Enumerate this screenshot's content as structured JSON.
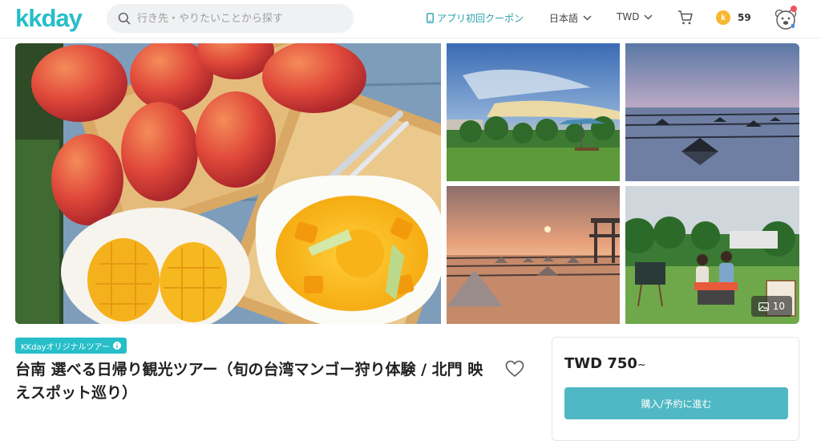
{
  "header": {
    "logo": "kkday",
    "search_placeholder": "行き先・やりたいことから探す",
    "coupon_label": "アプリ初回クーポン",
    "language_label": "日本語",
    "currency_label": "TWD",
    "points": "59",
    "points_coin": "k"
  },
  "gallery": {
    "photo_count": "10"
  },
  "product": {
    "badge": "KKdayオリジナルツアー",
    "title": "台南 選べる日帰り観光ツアー（旬の台湾マンゴー狩り体験 / 北門 映えスポット巡り）"
  },
  "booking": {
    "price": "TWD 750",
    "price_suffix": "~",
    "button_label": "購入/予約に進む"
  },
  "colors": {
    "brand": "#26bec9",
    "coupon": "#26a2ad",
    "button": "#4fb8c4",
    "points_coin": "#f7b731",
    "notification": "#f2545b"
  }
}
